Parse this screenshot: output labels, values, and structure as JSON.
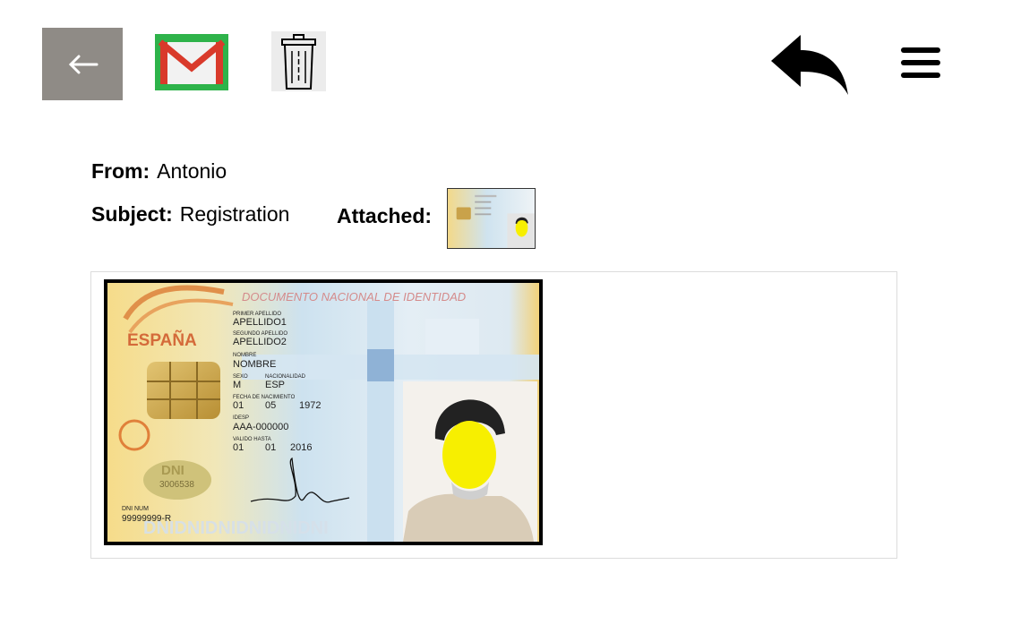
{
  "toolbar": {
    "back_icon": "arrow-left-icon",
    "gmail_icon": "gmail-icon",
    "delete_icon": "trash-icon",
    "reply_icon": "reply-icon",
    "menu_icon": "hamburger-menu-icon"
  },
  "email": {
    "from_label": "From:",
    "from_value": "Antonio",
    "subject_label": "Subject:",
    "subject_value": "Registration",
    "attached_label": "Attached:"
  },
  "id_card": {
    "header": "DOCUMENTO NACIONAL DE IDENTIDAD",
    "country": "ESPAÑA",
    "surname1_label": "PRIMER APELLIDO",
    "surname1": "APELLIDO1",
    "surname2_label": "SEGUNDO APELLIDO",
    "surname2": "APELLIDO2",
    "name_label": "NOMBRE",
    "name": "NOMBRE",
    "sex_label": "SEXO",
    "nationality_label": "NACIONALIDAD",
    "sex": "M",
    "nationality": "ESP",
    "dob_label": "FECHA DE NACIMIENTO",
    "dob_day": "01",
    "dob_month": "05",
    "dob_year": "1972",
    "idesp_label": "IDESP",
    "idesp": "AAA-000000",
    "valid_label": "VALIDO HASTA",
    "valid_day": "01",
    "valid_month": "01",
    "valid_year": "2016",
    "dni_badge": "DNI",
    "badge_number": "3006538",
    "dni_num_label": "DNI NUM",
    "dni_num": "99999999-R",
    "footer_pattern": "DNIDNIDNIDNIDNIDNI"
  },
  "colors": {
    "back_button_bg": "#8f8b86",
    "gmail_green": "#2eb34a",
    "gmail_red": "#d93a2b",
    "face_yellow": "#f7ef00"
  }
}
